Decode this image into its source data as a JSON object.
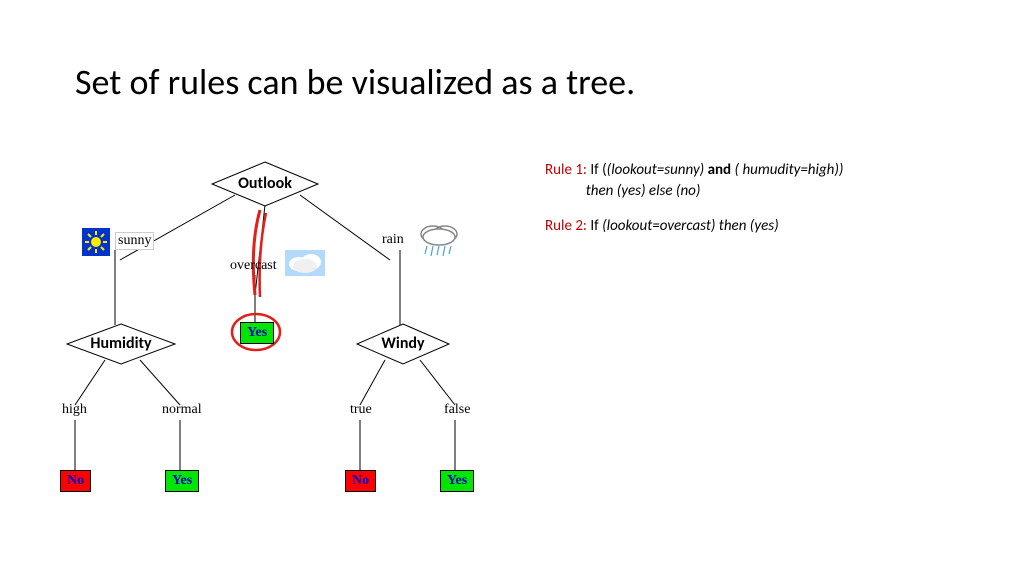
{
  "title": "Set of rules can be visualized as a tree.",
  "tree": {
    "root": "Outlook",
    "branches": {
      "sunny": "sunny",
      "overcast": "overcast",
      "rain": "rain"
    },
    "humidity": {
      "label": "Humidity",
      "high": "high",
      "normal": "normal"
    },
    "windy": {
      "label": "Windy",
      "true": "true",
      "false": "false"
    },
    "leaves": {
      "yes": "Yes",
      "no": "No"
    }
  },
  "rules": {
    "r1_label": "Rule 1: ",
    "r1_if": "If (",
    "r1_c1": "(lookout=sunny) ",
    "r1_and": "and",
    "r1_c2": " ( humudity=high))",
    "r1_then": "then (yes) else (no)",
    "r2_label": "Rule 2: ",
    "r2_if": "If ",
    "r2_body": "(lookout=overcast) then (yes)"
  }
}
